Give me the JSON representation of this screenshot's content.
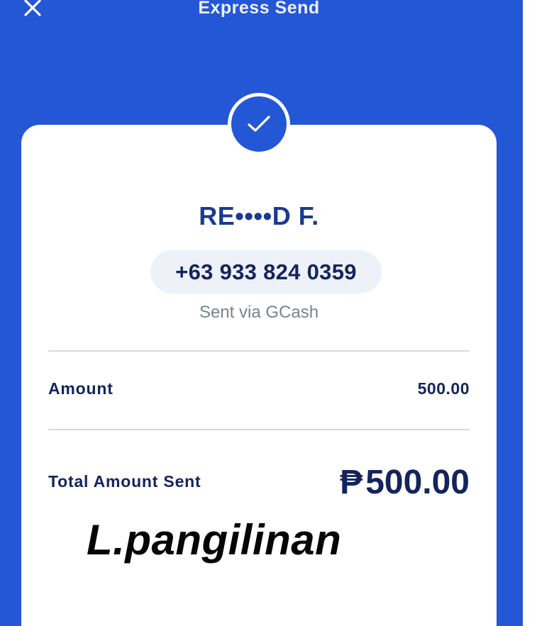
{
  "header": {
    "title": "Express Send",
    "close_icon": "close-icon"
  },
  "status": {
    "icon": "check-icon",
    "color": "#2457d6"
  },
  "recipient": {
    "name": "RE••••D F.",
    "phone": "+63 933 824 0359",
    "channel": "Sent via GCash"
  },
  "details": {
    "amount_label": "Amount",
    "amount_value": "500.00",
    "total_label": "Total Amount Sent",
    "currency_symbol": "₱",
    "total_value": "500.00"
  },
  "overlay": {
    "text": "L.pangilinan"
  },
  "colors": {
    "brand_blue": "#2457d6",
    "text_navy": "#14245c",
    "name_blue": "#1b3a8f"
  }
}
